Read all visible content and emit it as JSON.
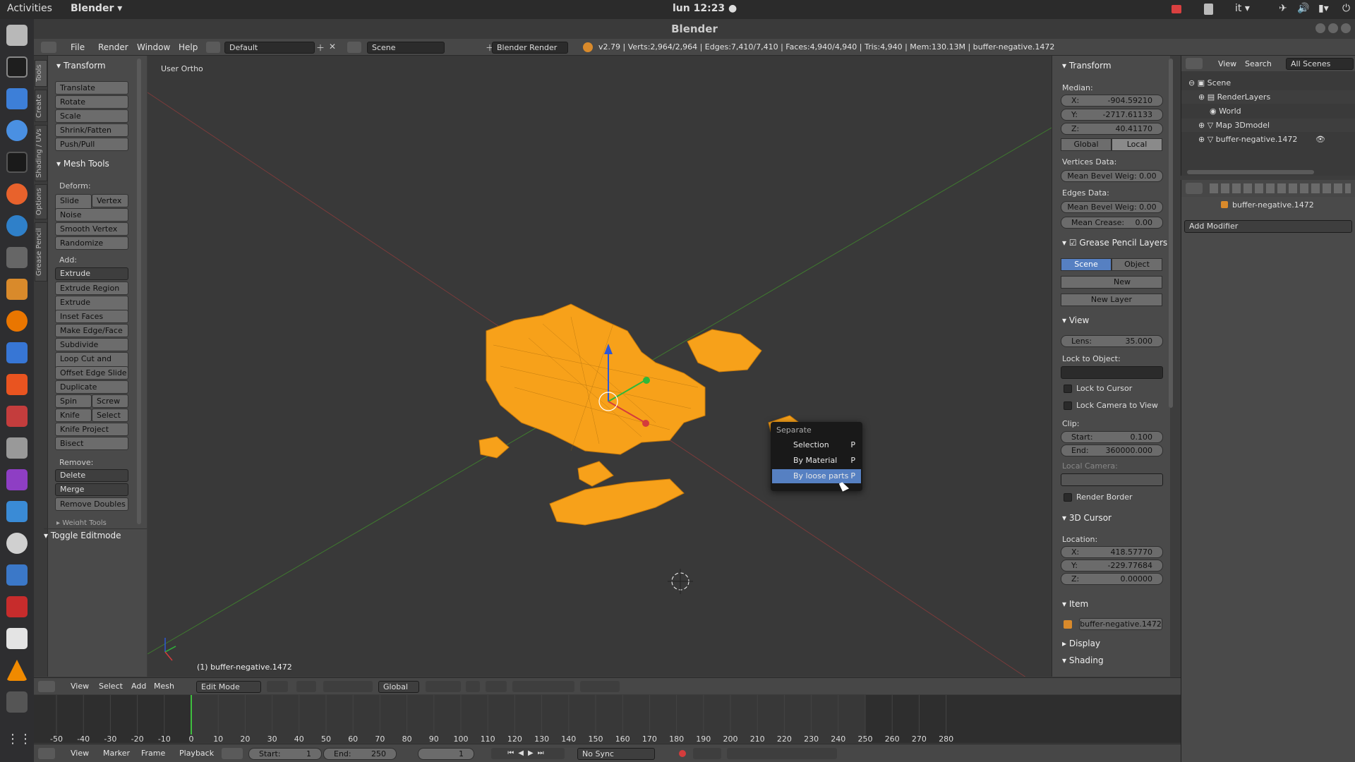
{
  "system": {
    "activities": "Activities",
    "app_menu": "Blender ▾",
    "clock": "lun 12:23 ●",
    "lang": "it ▾"
  },
  "window": {
    "title": "Blender"
  },
  "info_header": {
    "menus": [
      "File",
      "Render",
      "Window",
      "Help"
    ],
    "layout": "Default",
    "scene": "Scene",
    "engine": "Blender Render",
    "stats": "v2.79 | Verts:2,964/2,964 | Edges:7,410/7,410 | Faces:4,940/4,940 | Tris:4,940 | Mem:130.13M | buffer-negative.1472"
  },
  "left_tabs": [
    "Tools",
    "Create",
    "Shading / UVs",
    "Options",
    "Grease Pencil"
  ],
  "toolshelf": {
    "transform_header": "Transform",
    "transform": [
      "Translate",
      "Rotate",
      "Scale",
      "Shrink/Fatten",
      "Push/Pull"
    ],
    "mesh_tools_header": "Mesh Tools",
    "deform_label": "Deform:",
    "slide_edge": "Slide Ed",
    "vertex": "Vertex",
    "deform": [
      "Noise",
      "Smooth Vertex",
      "Randomize"
    ],
    "add_label": "Add:",
    "extrude": "Extrude",
    "add": [
      "Extrude Region",
      "Extrude Individual",
      "Inset Faces",
      "Make Edge/Face",
      "Subdivide",
      "Loop Cut and Slide",
      "Offset Edge Slide",
      "Duplicate"
    ],
    "spin": "Spin",
    "screw": "Screw",
    "knife": "Knife",
    "select": "Select",
    "knife_project": "Knife Project",
    "bisect": "Bisect",
    "remove_label": "Remove:",
    "delete": "Delete",
    "merge": "Merge",
    "remove_doubles": "Remove Doubles",
    "weight_tools": "Weight Tools",
    "toggle_editmode": "Toggle Editmode"
  },
  "viewport": {
    "view_name": "User Ortho",
    "object_label": "(1) buffer-negative.1472",
    "mesh_color": "#f7a11a"
  },
  "context_menu": {
    "title": "Separate",
    "items": [
      {
        "label": "Selection",
        "shortcut": "P"
      },
      {
        "label": "By Material",
        "shortcut": "P"
      },
      {
        "label": "By loose parts",
        "shortcut": "P"
      }
    ]
  },
  "npanel": {
    "transform_header": "Transform",
    "median_label": "Median:",
    "x_label": "X:",
    "x": "-904.59210",
    "y_label": "Y:",
    "y": "-2717.61133",
    "z_label": "Z:",
    "z": "40.41170",
    "global": "Global",
    "local": "Local",
    "vertices_data": "Vertices Data:",
    "mean_bevel": "Mean Bevel Weig: 0.00",
    "edges_data": "Edges Data:",
    "mean_bevel2": "Mean Bevel Weig: 0.00",
    "mean_crease_label": "Mean Crease:",
    "mean_crease": "0.00",
    "gp_header": "Grease Pencil Layers",
    "gp_scene": "Scene",
    "gp_object": "Object",
    "gp_new": "New",
    "gp_new_layer": "New Layer",
    "view_header": "View",
    "lens_label": "Lens:",
    "lens": "35.000",
    "lock_to_object": "Lock to Object:",
    "lock_to_cursor": "Lock to Cursor",
    "lock_camera": "Lock Camera to View",
    "clip": "Clip:",
    "start_label": "Start:",
    "start": "0.100",
    "end_label": "End:",
    "end": "360000.000",
    "local_camera": "Local Camera:",
    "render_border": "Render Border",
    "cursor_header": "3D Cursor",
    "location": "Location:",
    "cx_label": "X:",
    "cx": "418.57770",
    "cy_label": "Y:",
    "cy": "-229.77684",
    "cz_label": "Z:",
    "cz": "0.00000",
    "item_header": "Item",
    "item_name": "buffer-negative.1472",
    "display_header": "Display",
    "shading_header": "Shading"
  },
  "outliner": {
    "view": "View",
    "search": "Search",
    "filter": "All Scenes",
    "rows": [
      "Scene",
      "RenderLayers",
      "World",
      "Map 3Dmodel",
      "buffer-negative.1472"
    ]
  },
  "properties": {
    "object_name": "buffer-negative.1472",
    "add_modifier": "Add Modifier"
  },
  "view3d_header": {
    "view": "View",
    "select": "Select",
    "add": "Add",
    "mesh": "Mesh",
    "mode": "Edit Mode",
    "orientation": "Global"
  },
  "timeline": {
    "ticks": [
      "-50",
      "-40",
      "-30",
      "-20",
      "-10",
      "0",
      "10",
      "20",
      "30",
      "40",
      "50",
      "60",
      "70",
      "80",
      "90",
      "100",
      "110",
      "120",
      "130",
      "140",
      "150",
      "160",
      "170",
      "180",
      "190",
      "200",
      "210",
      "220",
      "230",
      "240",
      "250",
      "260",
      "270",
      "280"
    ],
    "menus": [
      "View",
      "Marker",
      "Frame",
      "Playback"
    ],
    "start_label": "Start:",
    "start": "1",
    "end_label": "End:",
    "end": "250",
    "current": "1",
    "sync": "No Sync"
  }
}
